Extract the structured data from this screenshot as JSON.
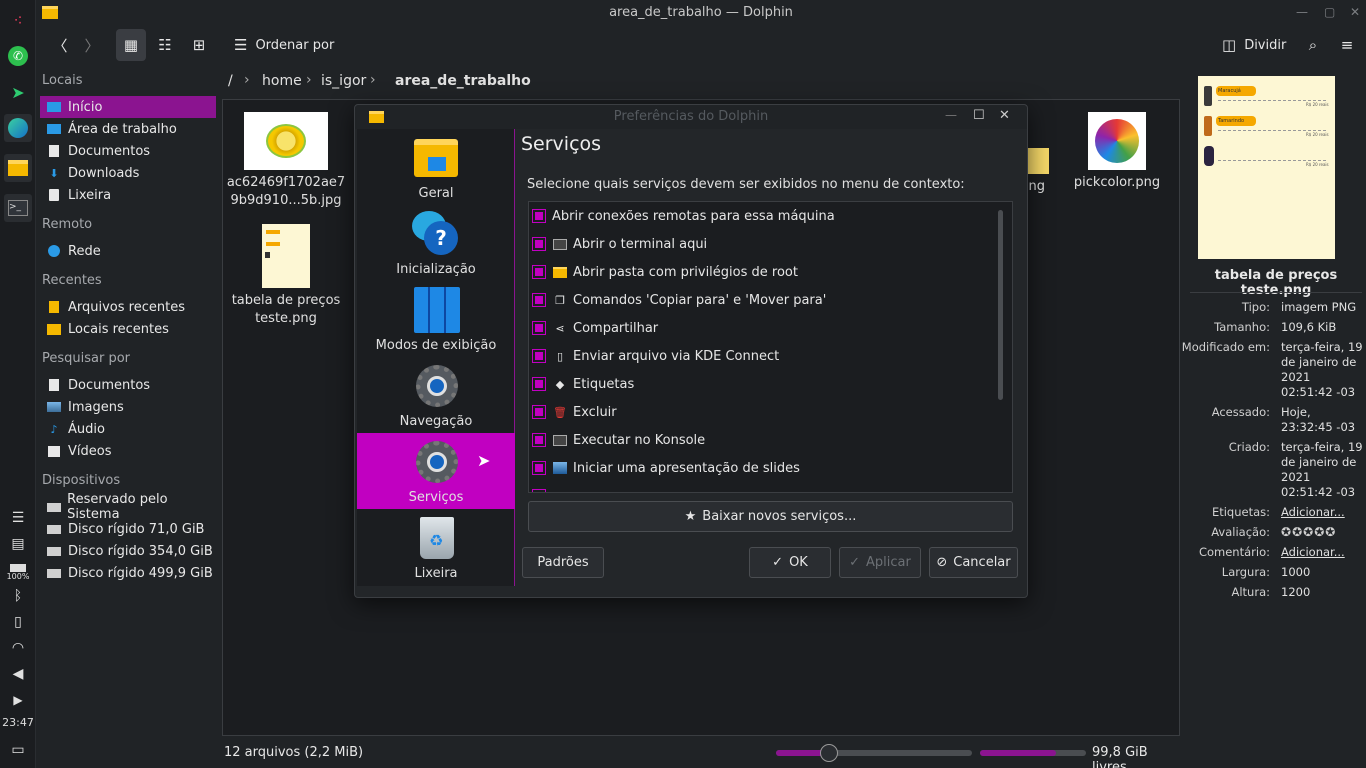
{
  "window": {
    "title": "area_de_trabalho — Dolphin",
    "clock": "23:47",
    "battery": "100%"
  },
  "toolbar": {
    "sort_label": "Ordenar por",
    "split_label": "Dividir"
  },
  "places": {
    "sections": [
      {
        "title": "Locais",
        "items": [
          "Início",
          "Área de trabalho",
          "Documentos",
          "Downloads",
          "Lixeira"
        ]
      },
      {
        "title": "Remoto",
        "items": [
          "Rede"
        ]
      },
      {
        "title": "Recentes",
        "items": [
          "Arquivos recentes",
          "Locais recentes"
        ]
      },
      {
        "title": "Pesquisar por",
        "items": [
          "Documentos",
          "Imagens",
          "Áudio",
          "Vídeos"
        ]
      },
      {
        "title": "Dispositivos",
        "items": [
          "Reservado pelo Sistema",
          "Disco rígido 71,0 GiB",
          "Disco rígido 354,0 GiB",
          "Disco rígido 499,9 GiB"
        ]
      }
    ]
  },
  "breadcrumb": [
    "/",
    "home",
    "is_igor",
    "area_de_trabalho"
  ],
  "files": [
    {
      "name1": "ac62469f1702ae7",
      "name2": "9b9d910...5b.jpg"
    },
    {
      "name1": "tabela de preços",
      "name2": "teste.png"
    },
    {
      "name1": "ong",
      "name2": ""
    },
    {
      "name1": "pickcolor.png",
      "name2": ""
    }
  ],
  "status": {
    "count": "12 arquivos (2,2 MiB)",
    "free": "99,8 GiB livres",
    "zoom_fraction": 0.27,
    "disk_used_fraction": 0.72
  },
  "info": {
    "filename": "tabela de preços teste.png",
    "preview": {
      "label1": "Maracujá",
      "label2": "Tamarindo",
      "price": "R$ 20 reais"
    },
    "rows": [
      {
        "k": "Tipo:",
        "v": "imagem PNG"
      },
      {
        "k": "Tamanho:",
        "v": "109,6 KiB"
      },
      {
        "k": "Modificado em:",
        "v": "terça-feira, 19 de janeiro de 2021 02:51:42 -03"
      },
      {
        "k": "Acessado:",
        "v": "Hoje, 23:32:45 -03"
      },
      {
        "k": "Criado:",
        "v": "terça-feira, 19 de janeiro de 2021 02:51:42 -03"
      },
      {
        "k": "Etiquetas:",
        "v": "Adicionar..."
      },
      {
        "k": "Avaliação:",
        "v": "0 of 5"
      },
      {
        "k": "Comentário:",
        "v": "Adicionar..."
      },
      {
        "k": "Largura:",
        "v": "1000"
      },
      {
        "k": "Altura:",
        "v": "1200"
      }
    ]
  },
  "dialog": {
    "title": "Preferências do Dolphin",
    "categories": [
      "Geral",
      "Inicialização",
      "Modos de exibição",
      "Navegação",
      "Serviços",
      "Lixeira"
    ],
    "heading": "Serviços",
    "description": "Selecione quais serviços devem ser exibidos no menu de contexto:",
    "services": [
      "Abrir conexões remotas para essa máquina",
      "Abrir o terminal aqui",
      "Abrir pasta com privilégios de root",
      "Comandos 'Copiar para' e 'Mover para'",
      "Compartilhar",
      "Enviar arquivo via KDE Connect",
      "Etiquetas",
      "Excluir",
      "Executar no Konsole",
      "Iniciar uma apresentação de slides"
    ],
    "download_label": "Baixar novos serviços...",
    "defaults_label": "Padrões",
    "ok_label": "OK",
    "apply_label": "Aplicar",
    "cancel_label": "Cancelar"
  },
  "colors": {
    "accent": "#c100c1",
    "active_place": "#8b1490",
    "link": "#3aa0e8",
    "bg": "#202326"
  }
}
